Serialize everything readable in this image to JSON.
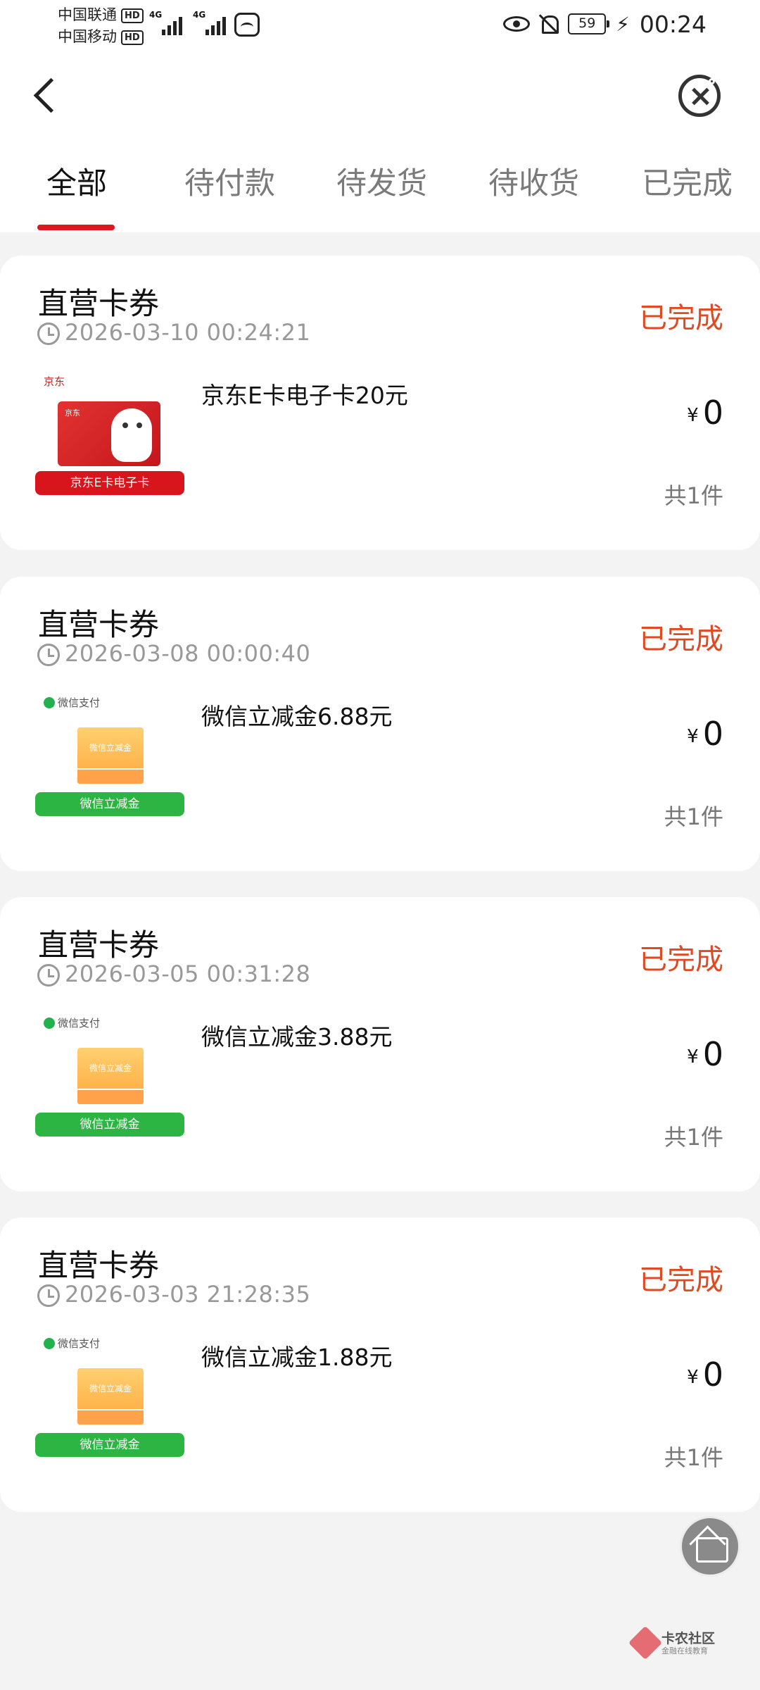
{
  "status_bar": {
    "carrier_1": "中国联通",
    "carrier_2": "中国移动",
    "hd_badge": "HD",
    "network_1": "4G",
    "network_2": "4G",
    "battery_level": "59",
    "time": "00:24"
  },
  "header": {
    "back_icon": "chevron-left-icon",
    "close_icon": "close-circle-icon"
  },
  "tabs": [
    {
      "label": "全部",
      "active": true
    },
    {
      "label": "待付款",
      "active": false
    },
    {
      "label": "待发货",
      "active": false
    },
    {
      "label": "待收货",
      "active": false
    },
    {
      "label": "已完成",
      "active": false
    }
  ],
  "colors": {
    "accent_red": "#e0161f",
    "status_orange": "#e04a22",
    "wechat_green": "#2db543"
  },
  "orders": [
    {
      "shop": "直营卡券",
      "time": "2026-03-10 00:24:21",
      "status": "已完成",
      "product_name": "京东E卡电子卡20元",
      "thumb_brand": "京东",
      "thumb_ribbon": "京东E卡电子卡",
      "currency": "¥",
      "price": "0",
      "quantity": "共1件"
    },
    {
      "shop": "直营卡券",
      "time": "2026-03-08 00:00:40",
      "status": "已完成",
      "product_name": "微信立减金6.88元",
      "thumb_brand": "微信支付",
      "thumb_coupon": "微信立减金",
      "thumb_ribbon": "微信立减金",
      "currency": "¥",
      "price": "0",
      "quantity": "共1件"
    },
    {
      "shop": "直营卡券",
      "time": "2026-03-05 00:31:28",
      "status": "已完成",
      "product_name": "微信立减金3.88元",
      "thumb_brand": "微信支付",
      "thumb_coupon": "微信立减金",
      "thumb_ribbon": "微信立减金",
      "currency": "¥",
      "price": "0",
      "quantity": "共1件"
    },
    {
      "shop": "直营卡券",
      "time": "2026-03-03 21:28:35",
      "status": "已完成",
      "product_name": "微信立减金1.88元",
      "thumb_brand": "微信支付",
      "thumb_coupon": "微信立减金",
      "thumb_ribbon": "微信立减金",
      "currency": "¥",
      "price": "0",
      "quantity": "共1件"
    }
  ],
  "floating": {
    "home_icon": "home-icon"
  },
  "watermark": {
    "title": "卡农社区",
    "subtitle": "金融在线教育"
  }
}
